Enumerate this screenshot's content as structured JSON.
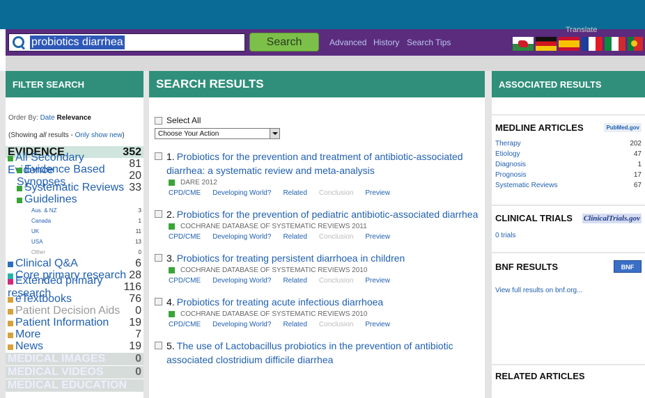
{
  "search": {
    "query": "probiotics diarrhea",
    "button_label": "Search",
    "links": [
      "Advanced",
      "History",
      "Search Tips"
    ],
    "translate_label": "Translate"
  },
  "flags": [
    "wales",
    "germany",
    "spain",
    "france",
    "italy",
    "portugal"
  ],
  "colors": {
    "accent_teal": "#2f8f7a",
    "search_bar": "#5b2b7e",
    "top_band": "#0a6b96",
    "link_blue": "#1f5fb0"
  },
  "filter": {
    "title": "FILTER SEARCH",
    "order_by_label": "Order By:",
    "order_date": "Date",
    "order_relevance": "Relevance",
    "showing_prefix": "(Showing ",
    "showing_all": "all",
    "showing_mid": " results - ",
    "only_new": "Only show new",
    "showing_suffix": ")",
    "evidence_label": "EVIDENCE",
    "evidence_count": "352",
    "items": [
      {
        "label": "All Secondary Evidence",
        "count": "81",
        "color": "#3aa536",
        "level": 0
      },
      {
        "label": "Evidence Based Synopses",
        "count": "20",
        "color": "#3aa536",
        "level": 1
      },
      {
        "label": "Systematic Reviews",
        "count": "33",
        "color": "#3aa536",
        "level": 1
      },
      {
        "label": "Guidelines",
        "count": "",
        "color": "#3aa536",
        "level": 1
      },
      {
        "label": "Aus. & NZ",
        "count": "3",
        "level": 2
      },
      {
        "label": "Canada",
        "count": "1",
        "level": 2
      },
      {
        "label": "UK",
        "count": "11",
        "level": 2
      },
      {
        "label": "USA",
        "count": "13",
        "level": 2
      },
      {
        "label": "Other",
        "count": "0",
        "level": 2,
        "dim": true
      },
      {
        "label": "Clinical Q&A",
        "count": "6",
        "color": "#2a6fc0",
        "level": 0
      },
      {
        "label": "Core primary research",
        "count": "28",
        "color": "#1fb6b0",
        "level": 0
      },
      {
        "label": "Extended primary research",
        "count": "116",
        "color": "#d6287a",
        "level": 0
      },
      {
        "label": "eTextbooks",
        "count": "76",
        "color": "#d9a13a",
        "level": 0
      },
      {
        "label": "Patient Decision Aids",
        "count": "0",
        "color": "#d9a13a",
        "level": 0,
        "dim": true
      },
      {
        "label": "Patient Information",
        "count": "19",
        "color": "#d9a13a",
        "level": 0
      },
      {
        "label": "More",
        "count": "7",
        "color": "#d9a13a",
        "level": 0
      },
      {
        "label": "News",
        "count": "19",
        "color": "#d9a13a",
        "level": 0
      }
    ],
    "gray_rows": [
      {
        "label": "MEDICAL IMAGES",
        "count": "0"
      },
      {
        "label": "MEDICAL VIDEOS",
        "count": "0"
      },
      {
        "label": "MEDICAL EDUCATION",
        "count": ""
      }
    ]
  },
  "results": {
    "title": "SEARCH RESULTS",
    "select_all": "Select All",
    "action_placeholder": "Choose Your Action",
    "link_labels": [
      "CPD/CME",
      "Developing World?",
      "Related",
      "Conclusion",
      "Preview"
    ],
    "items": [
      {
        "num": "1.",
        "line1": "Probiotics for the prevention and treatment of antibiotic-associated",
        "line2": "diarrhea: a systematic review and meta-analysis",
        "source": "DARE 2012"
      },
      {
        "num": "2.",
        "line1": "Probiotics for the prevention of pediatric antibiotic-associated diarrhea",
        "line2": "",
        "source": "COCHRANE DATABASE OF SYSTEMATIC REVIEWS 2011"
      },
      {
        "num": "3.",
        "line1": "Probiotics for treating persistent diarrhoea in children",
        "line2": "",
        "source": "COCHRANE DATABASE OF SYSTEMATIC REVIEWS 2010"
      },
      {
        "num": "4.",
        "line1": "Probiotics for treating acute infectious diarrhoea",
        "line2": "",
        "source": "COCHRANE DATABASE OF SYSTEMATIC REVIEWS 2010"
      },
      {
        "num": "5.",
        "line1": "The use of Lactobacillus probiotics in the prevention of antibiotic",
        "line2": "associated clostridium difficile diarrhea",
        "source": ""
      }
    ]
  },
  "associated": {
    "title": "ASSOCIATED RESULTS",
    "medline_title": "MEDLINE ARTICLES",
    "medline_logo": "PubMed.gov",
    "medline_rows": [
      {
        "label": "Therapy",
        "count": "202"
      },
      {
        "label": "Etiology",
        "count": "47"
      },
      {
        "label": "Diagnosis",
        "count": "1"
      },
      {
        "label": "Prognosis",
        "count": "17"
      },
      {
        "label": "Systematic Reviews",
        "count": "67"
      }
    ],
    "trials_title": "CLINICAL TRIALS",
    "trials_logo": "ClinicalTrials.gov",
    "trials_count": "0 trials",
    "bnf_title": "BNF RESULTS",
    "bnf_logo": "BNF",
    "bnf_link": "View full results on bnf.org...",
    "related_title": "RELATED ARTICLES"
  }
}
